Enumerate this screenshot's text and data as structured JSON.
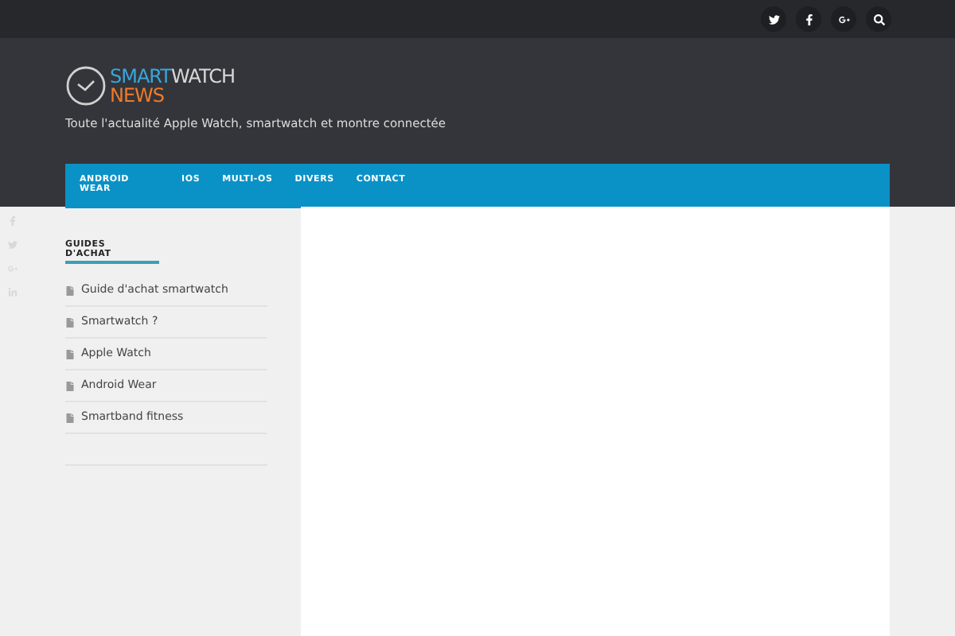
{
  "logo": {
    "word_1": "SMART",
    "word_2": "WATCH",
    "word_3": "NEWS"
  },
  "tagline": "Toute l'actualité Apple Watch, smartwatch et montre connectée",
  "nav": [
    "ANDROID WEAR",
    "IOS",
    "MULTI-OS",
    "DIVERS",
    "CONTACT"
  ],
  "sidebar": {
    "title": "GUIDES D'ACHAT",
    "items": [
      "Guide d'achat smartwatch",
      "Smartwatch ?",
      "Apple Watch",
      "Android Wear",
      "Smartband fitness"
    ]
  }
}
